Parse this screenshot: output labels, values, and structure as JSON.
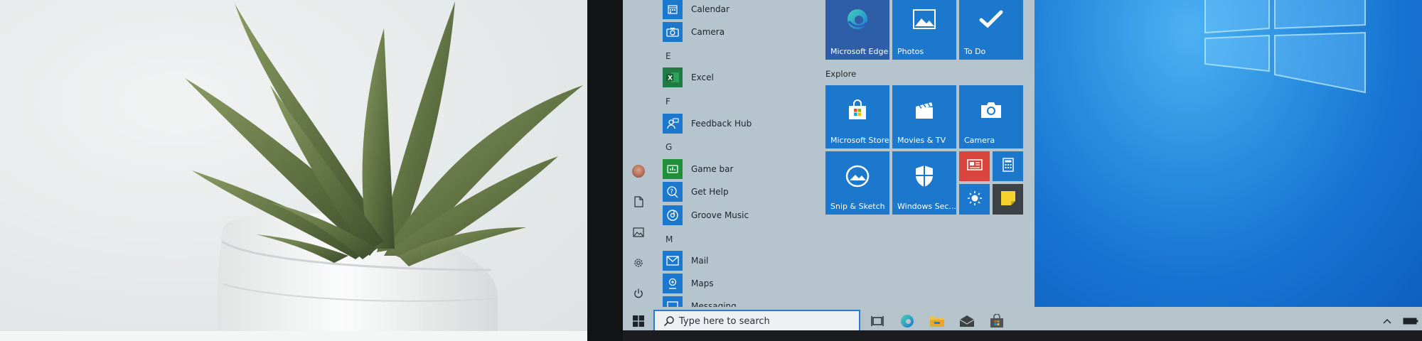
{
  "start_menu": {
    "apps": [
      {
        "label": "Calendar",
        "icon": "calendar-icon"
      },
      {
        "label": "Camera",
        "icon": "camera-icon"
      },
      {
        "letter": "E"
      },
      {
        "label": "Excel",
        "icon": "excel-icon"
      },
      {
        "letter": "F"
      },
      {
        "label": "Feedback Hub",
        "icon": "feedback-icon"
      },
      {
        "letter": "G"
      },
      {
        "label": "Game bar",
        "icon": "gamebar-icon"
      },
      {
        "label": "Get Help",
        "icon": "help-icon"
      },
      {
        "label": "Groove Music",
        "icon": "music-icon"
      },
      {
        "letter": "M"
      },
      {
        "label": "Mail",
        "icon": "mail-icon"
      },
      {
        "label": "Maps",
        "icon": "maps-icon"
      },
      {
        "label": "Messaging",
        "icon": "messaging-icon"
      }
    ],
    "tiles_top": [
      {
        "label": "Microsoft Edge",
        "icon": "edge-icon"
      },
      {
        "label": "Photos",
        "icon": "photos-icon"
      },
      {
        "label": "To Do",
        "icon": "todo-icon"
      }
    ],
    "group_explore": "Explore",
    "tiles_explore": [
      {
        "label": "Microsoft Store",
        "icon": "store-icon"
      },
      {
        "label": "Movies & TV",
        "icon": "movies-icon"
      },
      {
        "label": "Camera",
        "icon": "camera-icon"
      },
      {
        "label": "Snip & Sketch",
        "icon": "snip-icon"
      },
      {
        "label": "Windows Sec...",
        "icon": "shield-icon"
      }
    ],
    "small_tiles": [
      {
        "icon": "news-icon",
        "color": "#d9453c"
      },
      {
        "icon": "calculator-icon",
        "color": "#1b78cc"
      },
      {
        "icon": "weather-icon",
        "color": "#1b78cc"
      },
      {
        "icon": "sticky-notes-icon",
        "color": "#3c4246"
      }
    ]
  },
  "taskbar": {
    "search_placeholder": "Type here to search"
  },
  "colors": {
    "accent": "#1b78cc",
    "start_bg": "#b6c5cd",
    "desktop": "#1673d1"
  }
}
